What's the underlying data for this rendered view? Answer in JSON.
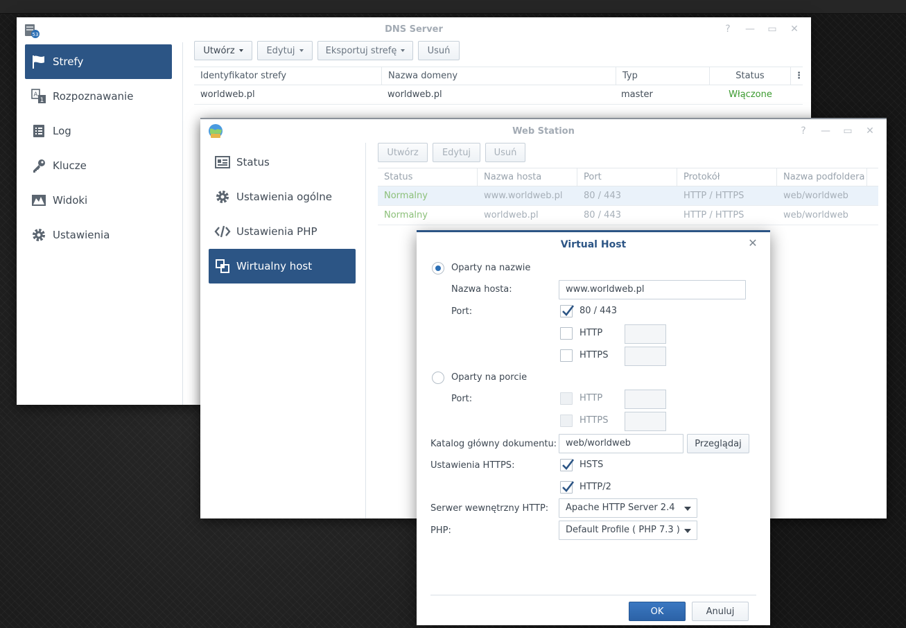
{
  "dns_window": {
    "title": "DNS Server",
    "sidebar": [
      {
        "label": "Strefy",
        "icon": "flag-icon",
        "active": true
      },
      {
        "label": "Rozpoznawanie",
        "icon": "resolution-icon",
        "active": false
      },
      {
        "label": "Log",
        "icon": "log-list-icon",
        "active": false
      },
      {
        "label": "Klucze",
        "icon": "key-icon",
        "active": false
      },
      {
        "label": "Widoki",
        "icon": "views-icon",
        "active": false
      },
      {
        "label": "Ustawienia",
        "icon": "gear-icon",
        "active": false
      }
    ],
    "toolbar": {
      "create": "Utwórz",
      "edit": "Edytuj",
      "export": "Eksportuj strefę",
      "delete": "Usuń"
    },
    "columns": [
      "Identyfikator strefy",
      "Nazwa domeny",
      "Typ",
      "Status"
    ],
    "rows": [
      {
        "zone_id": "worldweb.pl",
        "domain": "worldweb.pl",
        "type": "master",
        "status": "Włączone"
      }
    ]
  },
  "ws_window": {
    "title": "Web Station",
    "sidebar": [
      {
        "label": "Status",
        "icon": "status-card-icon",
        "active": false
      },
      {
        "label": "Ustawienia ogólne",
        "icon": "gear-icon",
        "active": false
      },
      {
        "label": "Ustawienia PHP",
        "icon": "code-icon",
        "active": false
      },
      {
        "label": "Wirtualny host",
        "icon": "virtual-host-icon",
        "active": true
      }
    ],
    "toolbar": {
      "create": "Utwórz",
      "edit": "Edytuj",
      "delete": "Usuń"
    },
    "columns": [
      "Status",
      "Nazwa hosta",
      "Port",
      "Protokół",
      "Nazwa podfoldera"
    ],
    "rows": [
      {
        "status": "Normalny",
        "host": "www.worldweb.pl",
        "port": "80 / 443",
        "protocol": "HTTP / HTTPS",
        "folder": "web/worldweb"
      },
      {
        "status": "Normalny",
        "host": "worldweb.pl",
        "port": "80 / 443",
        "protocol": "HTTP / HTTPS",
        "folder": "web/worldweb"
      }
    ]
  },
  "dialog": {
    "title": "Virtual Host",
    "name_based": {
      "label": "Oparty na nazwie",
      "selected": true
    },
    "hostname_label": "Nazwa hosta:",
    "hostname_value": "www.worldweb.pl",
    "port_label": "Port:",
    "port_default": {
      "label": "80 / 443",
      "checked": true
    },
    "http": {
      "label": "HTTP",
      "checked": false
    },
    "https": {
      "label": "HTTPS",
      "checked": false
    },
    "port_based": {
      "label": "Oparty na porcie",
      "selected": false
    },
    "port_label_2": "Port:",
    "pb_http": {
      "label": "HTTP"
    },
    "pb_https": {
      "label": "HTTPS"
    },
    "docroot_label": "Katalog główny dokumentu:",
    "docroot_value": "web/worldweb",
    "browse": "Przeglądaj",
    "https_settings_label": "Ustawienia HTTPS:",
    "hsts": {
      "label": "HSTS",
      "checked": true
    },
    "http2": {
      "label": "HTTP/2",
      "checked": true
    },
    "backend_label": "Serwer wewnętrzny HTTP:",
    "backend_value": "Apache HTTP Server 2.4",
    "php_label": "PHP:",
    "php_value": "Default Profile ( PHP 7.3 )",
    "ok": "OK",
    "cancel": "Anuluj"
  },
  "colors": {
    "accent": "#2c5585",
    "enabled_green": "#3a9a2e",
    "normal_green": "#8cc07a"
  }
}
